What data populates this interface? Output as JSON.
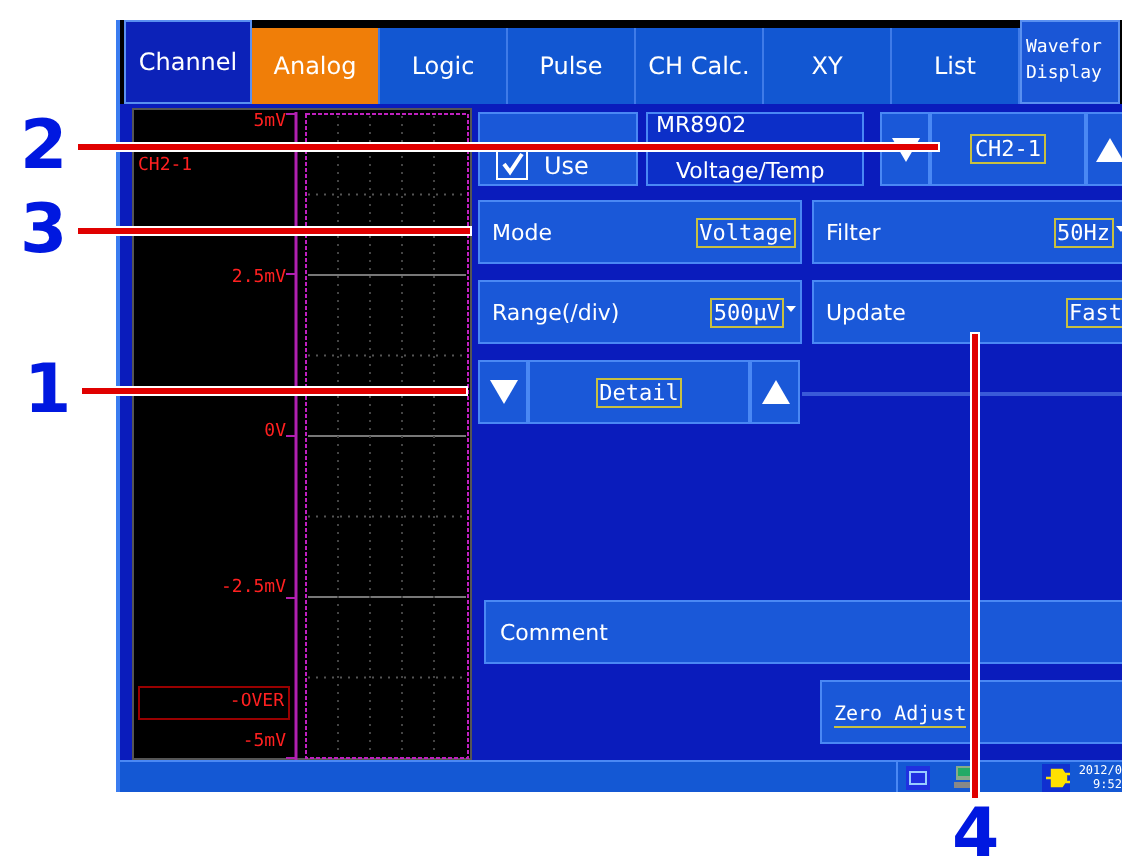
{
  "tabs": [
    {
      "label": "Channel",
      "kind": "main",
      "selected": true
    },
    {
      "label": "Analog",
      "kind": "sub",
      "selected": true
    },
    {
      "label": "Logic",
      "kind": "sub",
      "selected": false
    },
    {
      "label": "Pulse",
      "kind": "sub",
      "selected": false
    },
    {
      "label": "CH Calc.",
      "kind": "sub",
      "selected": false
    },
    {
      "label": "XY",
      "kind": "sub",
      "selected": false
    },
    {
      "label": "List",
      "kind": "sub",
      "selected": false
    },
    {
      "label": "Wavefor\nDisplay",
      "kind": "main",
      "selected": false
    }
  ],
  "waveform": {
    "channel": "CH2-1",
    "scale": [
      "5mV",
      "2.5mV",
      "0V",
      "-2.5mV",
      "-5mV"
    ],
    "over_label": "-OVER"
  },
  "channel_row": {
    "use": {
      "label": "Use",
      "checked": true
    },
    "module": [
      "MR8902",
      "Voltage/Temp"
    ],
    "channel": "CH2-1"
  },
  "settings": [
    {
      "label": "Mode",
      "value": "Voltage",
      "dropdown": false
    },
    {
      "label": "Filter",
      "value": "50Hz",
      "dropdown": true
    },
    {
      "label": "Range(/div)",
      "value": "500µV",
      "dropdown": true
    },
    {
      "label": "Update",
      "value": "Fast",
      "dropdown": false
    }
  ],
  "detail": {
    "label": "Detail"
  },
  "comment": {
    "label": "Comment"
  },
  "zero_adjust": {
    "label": "Zero Adjust"
  },
  "status_bar": {
    "date": "2012/0",
    "time": "9:52"
  },
  "callouts": [
    {
      "label": "2"
    },
    {
      "label": "3"
    },
    {
      "label": "1"
    },
    {
      "label": "4"
    }
  ]
}
